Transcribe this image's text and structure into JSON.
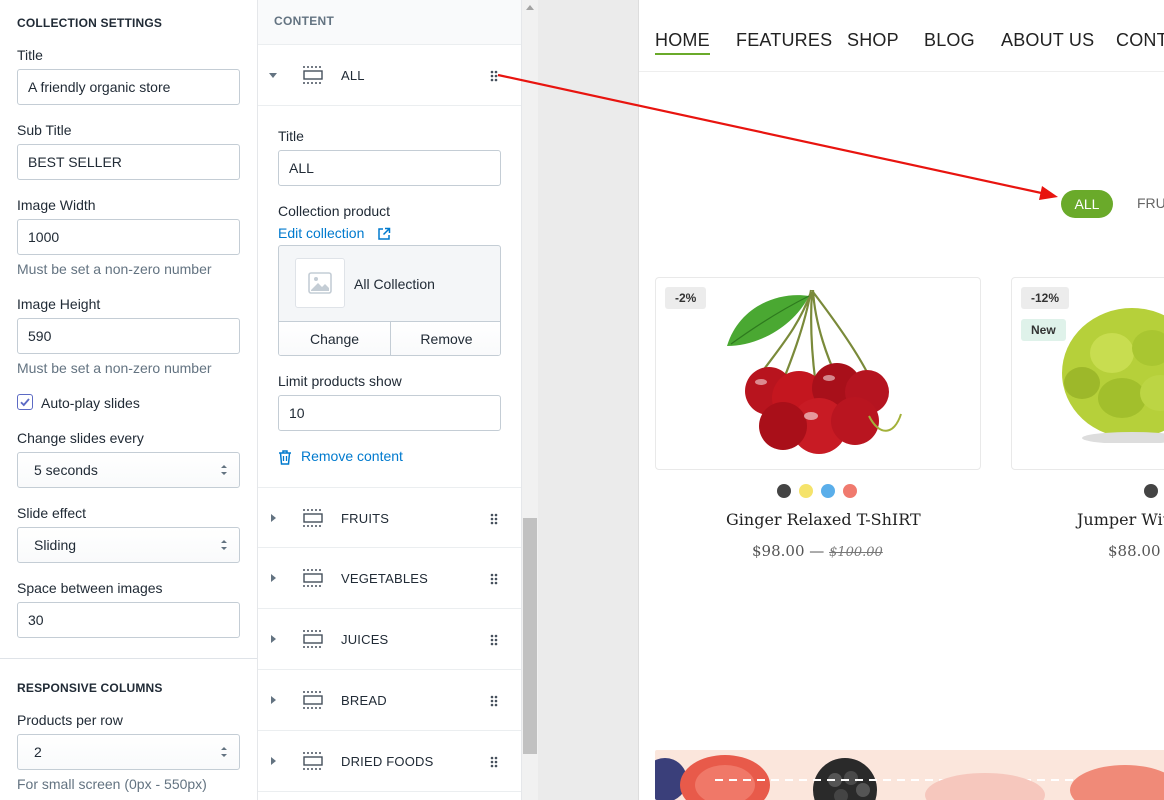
{
  "left": {
    "section_title": "COLLECTION SETTINGS",
    "title_label": "Title",
    "title_value": "A friendly organic store",
    "subtitle_label": "Sub Title",
    "subtitle_value": "BEST SELLER",
    "image_width_label": "Image Width",
    "image_width_value": "1000",
    "image_width_help": "Must be set a non-zero number",
    "image_height_label": "Image Height",
    "image_height_value": "590",
    "image_height_help": "Must be set a non-zero number",
    "autoplay_label": "Auto-play slides",
    "autoplay_checked": true,
    "change_slides_label": "Change slides every",
    "change_slides_value": "5 seconds",
    "slide_effect_label": "Slide effect",
    "slide_effect_value": "Sliding",
    "space_label": "Space between images",
    "space_value": "30",
    "responsive_title": "RESPONSIVE COLUMNS",
    "products_per_row_label": "Products per row",
    "products_per_row_value": "2",
    "small_screen_help": "For small screen (0px - 550px)"
  },
  "mid": {
    "header": "CONTENT",
    "blocks": [
      {
        "name": "ALL",
        "expanded": true
      },
      {
        "name": "FRUITS",
        "expanded": false
      },
      {
        "name": "VEGETABLES",
        "expanded": false
      },
      {
        "name": "JUICES",
        "expanded": false
      },
      {
        "name": "BREAD",
        "expanded": false
      },
      {
        "name": "DRIED FOODS",
        "expanded": false
      }
    ],
    "title_label": "Title",
    "title_value": "ALL",
    "collection_label": "Collection product",
    "edit_collection": "Edit collection",
    "collection_name": "All Collection",
    "change_button": "Change",
    "remove_button": "Remove",
    "limit_label": "Limit products show",
    "limit_value": "10",
    "remove_content": "Remove content"
  },
  "preview": {
    "nav": [
      "HOME",
      "FEATURES",
      "SHOP",
      "BLOG",
      "ABOUT US",
      "CONT"
    ],
    "active_nav": "HOME",
    "filter_active": "ALL",
    "filter_next": "FRU",
    "accent_color": "#6aaa2a",
    "products": [
      {
        "badges": [
          "-2%"
        ],
        "colors": [
          "#444444",
          "#f5e36b",
          "#5aaeea",
          "#f07a6e"
        ],
        "name": "Ginger Relaxed T-ShIRT",
        "price": "$98.00",
        "separator": "—",
        "old_price": "$100.00"
      },
      {
        "badges": [
          "-12%",
          "New"
        ],
        "colors": [
          "#444444"
        ],
        "name": "Jumper Wit",
        "price": "$88.00"
      }
    ]
  }
}
